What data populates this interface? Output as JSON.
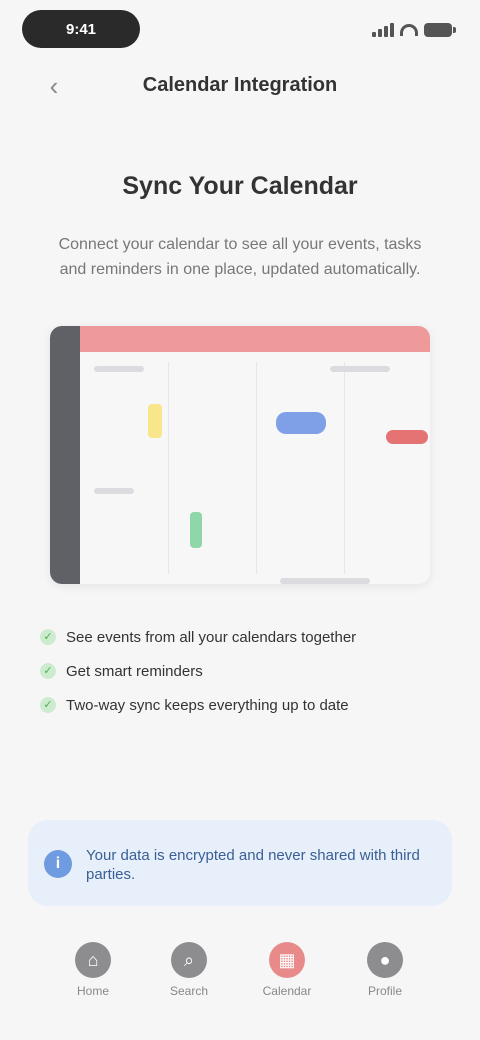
{
  "status_bar": {
    "time": "9:41"
  },
  "nav": {
    "back_icon": "chevron-left-icon",
    "title": "Calendar Integration"
  },
  "hero": {
    "title": "Sync Your Calendar",
    "description": "Connect your calendar to see all your events, tasks and reminders in one place, updated automatically."
  },
  "features": [
    {
      "icon": "check-icon",
      "text": "See events from all your calendars together"
    },
    {
      "icon": "check-icon",
      "text": "Get smart reminders"
    },
    {
      "icon": "check-icon",
      "text": "Two-way sync keeps everything up to date"
    }
  ],
  "notice": {
    "icon": "info-icon",
    "text": "Your data is encrypted and never shared with third parties."
  },
  "tabs": [
    {
      "label": "Home",
      "icon": "home-icon",
      "active": false
    },
    {
      "label": "Search",
      "icon": "search-icon",
      "active": false
    },
    {
      "label": "Calendar",
      "icon": "calendar-icon",
      "active": true
    },
    {
      "label": "Profile",
      "icon": "profile-icon",
      "active": false
    }
  ],
  "colors": {
    "accent": "#e88a8a",
    "info": "#6f9be0",
    "success": "#4caf50"
  }
}
